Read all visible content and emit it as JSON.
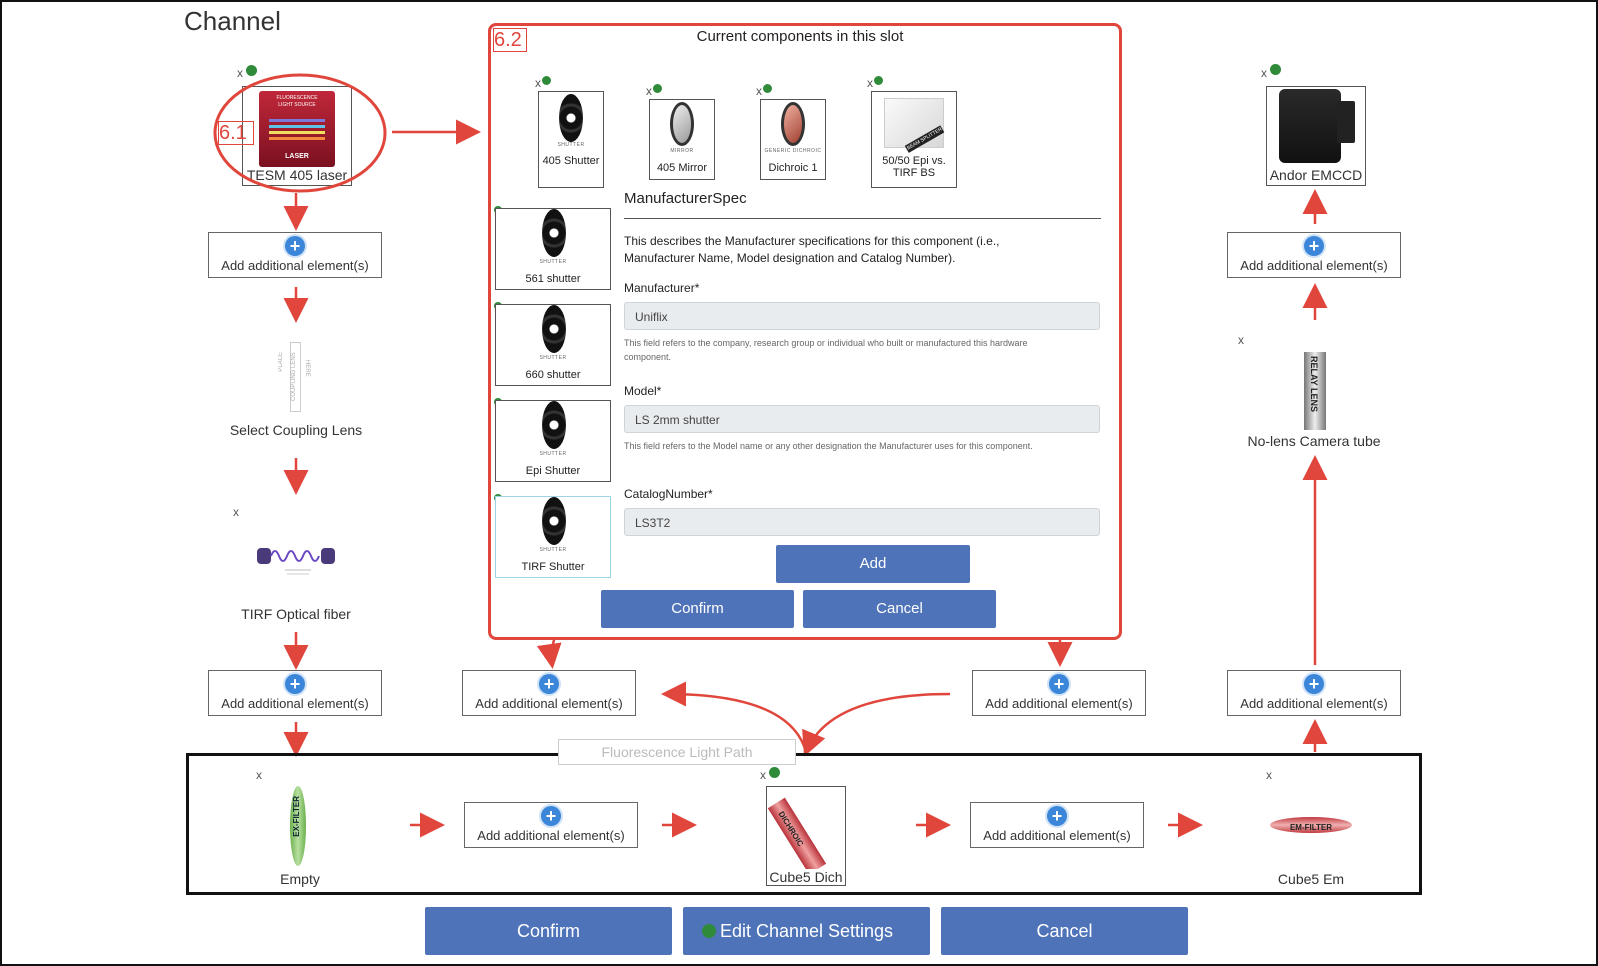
{
  "page_title": "Channel",
  "left_column": {
    "light_source_label": "TESM 405 laser",
    "light_source_art": [
      "FLUORESCENCE",
      "LIGHT SOURCE",
      "LASER"
    ],
    "add_1": "Add additional element(s)",
    "coupling_lens_label": "Select Coupling Lens",
    "coupling_lens_art": [
      "PLACE",
      "COUPLING LENS",
      "HERE"
    ],
    "fiber_label": "TIRF Optical fiber",
    "add_2": "Add additional element(s)"
  },
  "annotations": {
    "badge_1": "6.1",
    "badge_2": "6.2"
  },
  "slot_panel": {
    "title": "Current components in this slot",
    "chain": [
      {
        "caption": "SHUTTER",
        "label": "405 Shutter"
      },
      {
        "caption": "MIRROR",
        "label": "405 Mirror"
      },
      {
        "caption": "GENERIC DICHROIC",
        "label": "Dichroic 1"
      },
      {
        "caption": "BEAM SPLITTER",
        "label": "50/50 Epi vs. TIRF BS"
      }
    ],
    "options": [
      {
        "caption": "SHUTTER",
        "label": "561 shutter"
      },
      {
        "caption": "SHUTTER",
        "label": "660 shutter"
      },
      {
        "caption": "SHUTTER",
        "label": "Epi Shutter"
      },
      {
        "caption": "SHUTTER",
        "label": "TIRF Shutter"
      }
    ],
    "spec_title": "ManufacturerSpec",
    "spec_desc": "This describes the Manufacturer specifications for this component (i.e., Manufacturer Name, Model designation and Catalog Number).",
    "manufacturer_label": "Manufacturer*",
    "manufacturer_value": "Uniflix",
    "manufacturer_help": "This field refers to the company, research group or individual who built or manufactured this hardware component.",
    "model_label": "Model*",
    "model_value": "LS 2mm shutter",
    "model_help": "This field refers to the Model name or any other designation the Manufacturer uses for this component.",
    "catalog_label": "CatalogNumber*",
    "catalog_value": "LS3T2",
    "add_button": "Add",
    "confirm_button": "Confirm",
    "cancel_button": "Cancel"
  },
  "right_column": {
    "camera_label": "Andor EMCCD",
    "add_top": "Add additional element(s)",
    "tube_label": "No-lens Camera tube",
    "tube_art": "RELAY LENS",
    "add_bottom": "Add additional element(s)"
  },
  "middle_adds": {
    "left": "Add additional element(s)",
    "right": "Add additional element(s)"
  },
  "light_path": {
    "title": "Fluorescence Light Path",
    "ex_filter_label": "Empty",
    "ex_filter_art": "EX-FILTER",
    "add_1": "Add additional element(s)",
    "dichroic_label": "Cube5 Dich",
    "dichroic_art": "DICHROIC",
    "add_2": "Add additional element(s)",
    "em_filter_label": "Cube5 Em",
    "em_filter_art": "EM-FILTER"
  },
  "bottom_bar": {
    "confirm": "Confirm",
    "edit": "Edit Channel Settings",
    "cancel": "Cancel"
  },
  "icons": {
    "remove": "x",
    "add": "+"
  },
  "colors": {
    "accent_red": "#e0463c",
    "button_blue": "#4f73b8",
    "status_green": "#2f8a3a",
    "add_blue": "#3b86d8"
  }
}
